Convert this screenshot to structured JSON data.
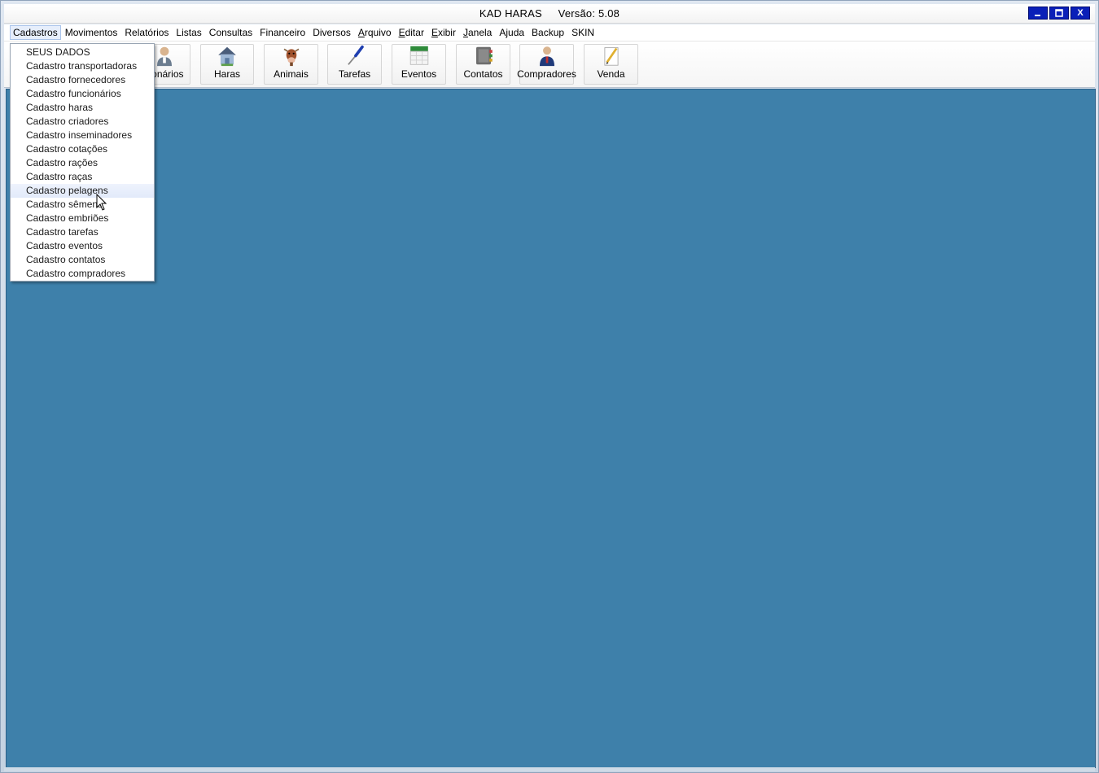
{
  "window": {
    "app_name": "KAD HARAS",
    "version": "Versão: 5.08",
    "controls": {
      "minimize": "_",
      "maximize": "□",
      "close": "X"
    }
  },
  "menubar": {
    "items": [
      {
        "label": "Cadastros",
        "active": true
      },
      {
        "label": "Movimentos"
      },
      {
        "label": "Relatórios"
      },
      {
        "label": "Listas"
      },
      {
        "label": "Consultas"
      },
      {
        "label": "Financeiro"
      },
      {
        "label": "Diversos"
      },
      {
        "label": "Arquivo",
        "underline": true
      },
      {
        "label": "Editar",
        "underline": true
      },
      {
        "label": "Exibir",
        "underline": true
      },
      {
        "label": "Janela",
        "underline": true
      },
      {
        "label": "Ajuda"
      },
      {
        "label": "Backup"
      },
      {
        "label": "SKIN"
      }
    ]
  },
  "toolbar": {
    "buttons": [
      {
        "label": "cionários",
        "icon": "person-icon"
      },
      {
        "label": "Haras",
        "icon": "house-icon"
      },
      {
        "label": "Animais",
        "icon": "cow-icon"
      },
      {
        "label": "Tarefas",
        "icon": "screwdriver-icon"
      },
      {
        "label": "Eventos",
        "icon": "calendar-icon"
      },
      {
        "label": "Contatos",
        "icon": "address-book-icon"
      },
      {
        "label": "Compradores",
        "icon": "buyer-person-icon"
      },
      {
        "label": "Venda",
        "icon": "pencil-paper-icon"
      }
    ]
  },
  "dropdown": {
    "items": [
      "SEUS DADOS",
      "Cadastro transportadoras",
      "Cadastro fornecedores",
      "Cadastro funcionários",
      "Cadastro haras",
      "Cadastro criadores",
      "Cadastro inseminadores",
      "Cadastro cotações",
      "Cadastro rações",
      "Cadastro raças",
      "Cadastro pelagens",
      "Cadastro sêmens",
      "Cadastro embriões",
      "Cadastro tarefas",
      "Cadastro eventos",
      "Cadastro contatos",
      "Cadastro compradores"
    ],
    "hovered_index": 10
  },
  "colors": {
    "workspace": "#3e80aa",
    "title_buttons": "#0a1fb8",
    "menu_hover": "#e6eefb"
  }
}
